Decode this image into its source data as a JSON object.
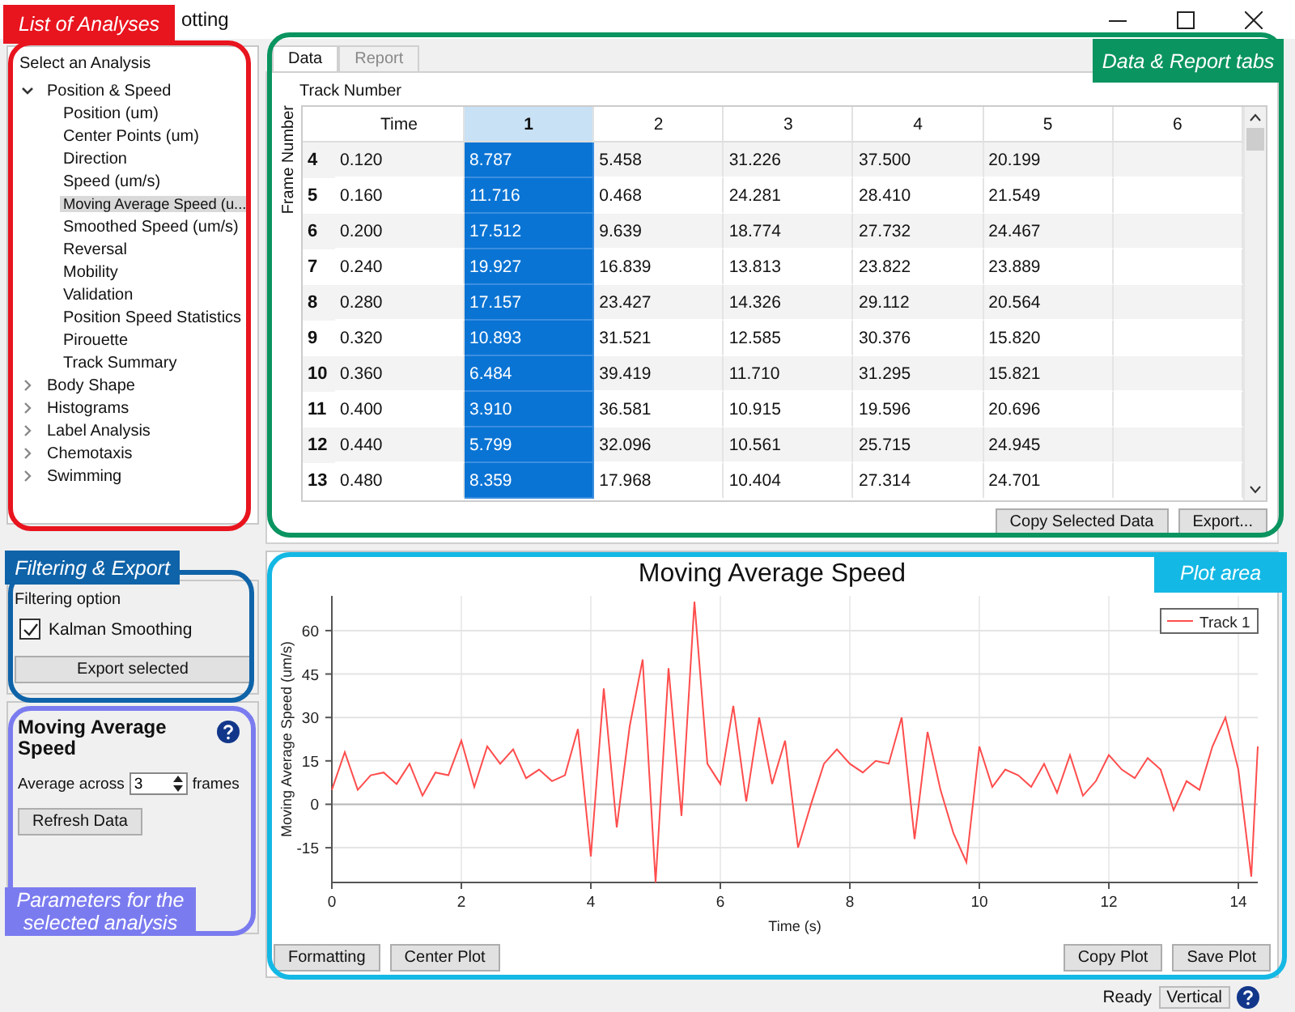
{
  "window": {
    "title": "otting"
  },
  "tree": {
    "label": "Select an Analysis",
    "items": [
      {
        "label": "Position & Speed",
        "expanded": true,
        "selected": false,
        "children": [
          {
            "label": "Position (um)",
            "selected": false
          },
          {
            "label": "Center Points (um)",
            "selected": false
          },
          {
            "label": "Direction",
            "selected": false
          },
          {
            "label": "Speed (um/s)",
            "selected": false
          },
          {
            "label": "Moving Average Speed (u...",
            "selected": true
          },
          {
            "label": "Smoothed Speed (um/s)",
            "selected": false
          },
          {
            "label": "Reversal",
            "selected": false
          },
          {
            "label": "Mobility",
            "selected": false
          },
          {
            "label": "Validation",
            "selected": false
          },
          {
            "label": "Position Speed Statistics",
            "selected": false
          },
          {
            "label": "Pirouette",
            "selected": false
          },
          {
            "label": "Track Summary",
            "selected": false
          }
        ]
      },
      {
        "label": "Body Shape",
        "expanded": false,
        "selected": false
      },
      {
        "label": "Histograms",
        "expanded": false,
        "selected": false
      },
      {
        "label": "Label Analysis",
        "expanded": false,
        "selected": false
      },
      {
        "label": "Chemotaxis",
        "expanded": false,
        "selected": false
      },
      {
        "label": "Swimming",
        "expanded": false,
        "selected": false
      }
    ]
  },
  "filtering": {
    "title": "Filtering option",
    "checkbox": {
      "label": "Kalman Smoothing",
      "checked": true
    },
    "button": "Export selected"
  },
  "parameters": {
    "title": "Moving Average Speed",
    "field_label": "Average across",
    "value": "3",
    "unit": "frames",
    "button": "Refresh Data"
  },
  "tabs": [
    {
      "label": "Data",
      "selected": true
    },
    {
      "label": "Report",
      "selected": false
    }
  ],
  "table": {
    "column_group": "Track Number",
    "row_group": "Frame Number",
    "columns": [
      {
        "label": "Time",
        "selected": false
      },
      {
        "label": "1",
        "selected": true
      },
      {
        "label": "2",
        "selected": false
      },
      {
        "label": "3",
        "selected": false
      },
      {
        "label": "4",
        "selected": false
      },
      {
        "label": "5",
        "selected": false
      },
      {
        "label": "6",
        "selected": false
      }
    ],
    "rows": [
      {
        "header": "4",
        "cells": [
          "0.120",
          "8.787",
          "5.458",
          "31.226",
          "37.500",
          "20.199"
        ]
      },
      {
        "header": "5",
        "cells": [
          "0.160",
          "11.716",
          "0.468",
          "24.281",
          "28.410",
          "21.549"
        ]
      },
      {
        "header": "6",
        "cells": [
          "0.200",
          "17.512",
          "9.639",
          "18.774",
          "27.732",
          "24.467"
        ]
      },
      {
        "header": "7",
        "cells": [
          "0.240",
          "19.927",
          "16.839",
          "13.813",
          "23.822",
          "23.889"
        ]
      },
      {
        "header": "8",
        "cells": [
          "0.280",
          "17.157",
          "23.427",
          "14.326",
          "29.112",
          "20.564"
        ]
      },
      {
        "header": "9",
        "cells": [
          "0.320",
          "10.893",
          "31.521",
          "12.585",
          "30.376",
          "15.820"
        ]
      },
      {
        "header": "10",
        "cells": [
          "0.360",
          "6.484",
          "39.419",
          "11.710",
          "31.295",
          "15.821"
        ]
      },
      {
        "header": "11",
        "cells": [
          "0.400",
          "3.910",
          "36.581",
          "10.915",
          "19.596",
          "20.696"
        ]
      },
      {
        "header": "12",
        "cells": [
          "0.440",
          "5.799",
          "32.096",
          "10.561",
          "25.715",
          "24.945"
        ]
      },
      {
        "header": "13",
        "cells": [
          "0.480",
          "8.359",
          "17.968",
          "10.404",
          "27.314",
          "24.701"
        ]
      }
    ]
  },
  "table_buttons": [
    "Copy Selected Data",
    "Export..."
  ],
  "plot": {
    "chart_data": {
      "type": "line",
      "grid": true,
      "title": "Moving Average Speed",
      "xlabel": "Time (s)",
      "ylabel": "Moving Average Speed (um/s)",
      "xlim": [
        0,
        14.3
      ],
      "ylim": [
        -27,
        72
      ],
      "xticks": [
        0,
        2,
        4,
        6,
        8,
        10,
        12,
        14
      ],
      "yticks": [
        -15,
        0,
        15,
        30,
        45,
        60
      ],
      "x": [
        0,
        0.2,
        0.4,
        0.6,
        0.8,
        1.0,
        1.2,
        1.4,
        1.6,
        1.8,
        2.0,
        2.2,
        2.4,
        2.6,
        2.8,
        3.0,
        3.2,
        3.4,
        3.6,
        3.8,
        4.0,
        4.2,
        4.4,
        4.6,
        4.8,
        5.0,
        5.2,
        5.4,
        5.6,
        5.8,
        6.0,
        6.2,
        6.4,
        6.6,
        6.8,
        7.0,
        7.2,
        7.4,
        7.6,
        7.8,
        8.0,
        8.2,
        8.4,
        8.6,
        8.8,
        9.0,
        9.2,
        9.4,
        9.6,
        9.8,
        10.0,
        10.2,
        10.4,
        10.6,
        10.8,
        11.0,
        11.2,
        11.4,
        11.6,
        11.8,
        12.0,
        12.2,
        12.4,
        12.6,
        12.8,
        13.0,
        13.2,
        13.4,
        13.6,
        13.8,
        14.0,
        14.2,
        14.3
      ],
      "series": [
        {
          "name": "Track 1",
          "color": "#ff4d4d",
          "values": [
            5,
            18,
            5,
            10,
            11,
            7,
            14,
            3,
            11,
            10,
            22,
            6,
            20,
            14,
            19,
            9,
            12,
            8,
            10,
            26,
            -18,
            40,
            -8,
            27,
            50,
            -27,
            47,
            -4,
            70,
            14,
            7,
            34,
            1,
            30,
            7,
            22,
            -15,
            0,
            14,
            19,
            14,
            11,
            15,
            14,
            30,
            -12,
            25,
            5,
            -10,
            -20,
            20,
            6,
            12,
            10,
            6,
            14,
            4,
            17,
            3,
            8,
            17,
            12,
            9,
            16,
            12,
            -2,
            8,
            5,
            20,
            30,
            12,
            -25,
            20
          ]
        }
      ]
    },
    "buttons_left": [
      "Formatting",
      "Center Plot"
    ],
    "buttons_right": [
      "Copy Plot",
      "Save Plot"
    ]
  },
  "status_bar": {
    "message": "Ready",
    "orientation": "Vertical"
  },
  "annotations": [
    {
      "label": "List of Analyses",
      "color": "#e8141e"
    },
    {
      "label": "Data & Report tabs",
      "color": "#0a9460"
    },
    {
      "label": "Filtering & Export",
      "color": "#0f63a8"
    },
    {
      "label": "Plot area",
      "color": "#14b8e4"
    },
    {
      "label": "Parameters for the selected analysis",
      "color": "#7b7bf0"
    }
  ]
}
